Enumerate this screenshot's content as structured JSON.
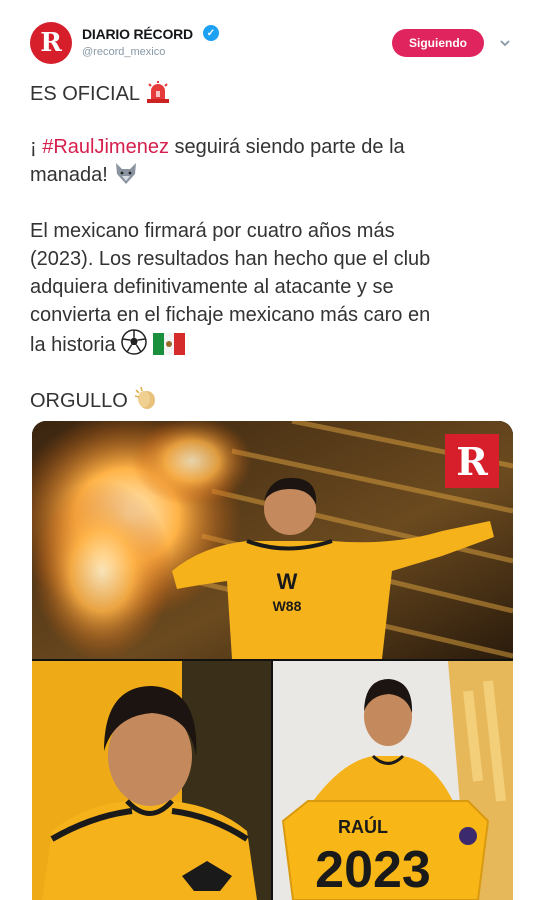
{
  "account": {
    "display_name": "DIARIO RÉCORD",
    "handle": "@record_mexico",
    "avatar_letter": "R",
    "follow_label": "Siguiendo"
  },
  "tweet": {
    "line1": "ES OFICIAL",
    "line2_prefix": "¡ ",
    "hashtag": "#RaulJimenez",
    "line2_rest": " seguirá siendo parte de la",
    "line3": "manada!",
    "paragraph": [
      "El mexicano firmará por cuatro años más",
      "(2023). Los resultados han hecho que el club",
      "adquiera definitivamente al atacante y se",
      "convierta en el fichaje mexicano más caro en",
      "la historia"
    ],
    "closing": "ORGULLO"
  },
  "media": {
    "logo_letter": "R",
    "jersey_sponsor": "W88",
    "jersey_name": "RAÚL",
    "jersey_number": "2023"
  },
  "colors": {
    "accent": "#e0245e",
    "hashtag": "#d6214e",
    "brand": "#d61f2b",
    "verified": "#1da1f2",
    "jersey": "#f6b21b"
  }
}
